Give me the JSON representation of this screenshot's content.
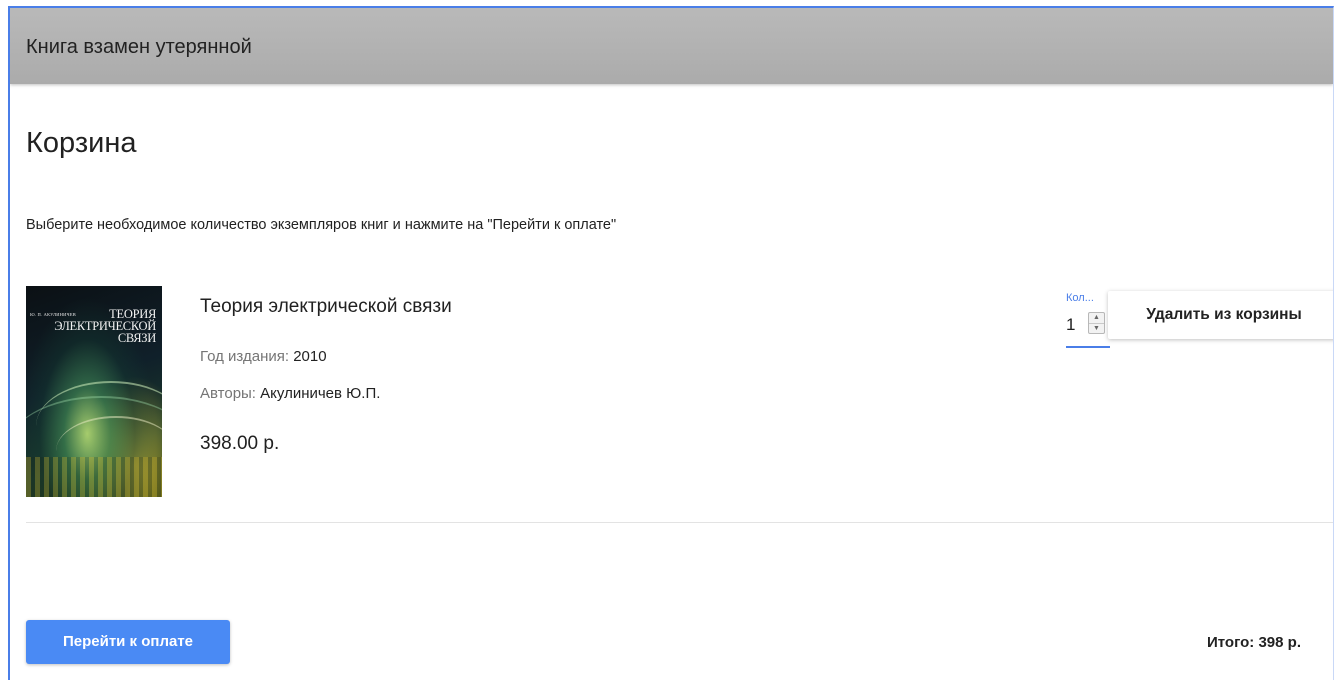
{
  "header": {
    "title": "Книга взамен утерянной"
  },
  "page": {
    "title": "Корзина",
    "instructions": "Выберите необходимое количество экземпляров книг и нажмите на \"Перейти к оплате\""
  },
  "cart": {
    "items": [
      {
        "cover": {
          "author": "Ю. П. АКУЛИНИЧЕВ",
          "title": "ТЕОРИЯ ЭЛЕКТРИЧЕСКОЙ СВЯЗИ"
        },
        "title": "Теория электрической связи",
        "year_label": "Год издания:",
        "year": "2010",
        "authors_label": "Авторы:",
        "authors": "Акулиничев Ю.П.",
        "price": "398.00 р.",
        "quantity_label": "Кол...",
        "quantity": "1",
        "remove_label": "Удалить из корзины"
      }
    ]
  },
  "footer": {
    "pay_label": "Перейти к оплате",
    "total_label": "Итого:",
    "total_value": "398 р."
  },
  "colors": {
    "accent": "#4a8af4",
    "header_bg": "#b3b3b3",
    "field_underline": "#4a7ee8"
  },
  "icons": {
    "stepper": "spinner-arrows-icon"
  }
}
